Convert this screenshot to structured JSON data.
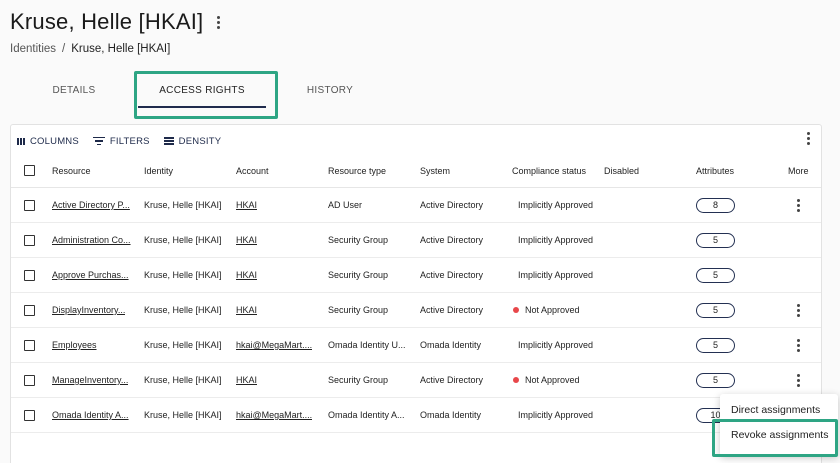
{
  "page": {
    "title": "Kruse, Helle [HKAI]",
    "title_menu_icon": "more-vertical-icon"
  },
  "breadcrumb": {
    "parent": "Identities",
    "separator": "/",
    "current": "Kruse, Helle [HKAI]"
  },
  "tabs": [
    {
      "label": "DETAILS",
      "active": false
    },
    {
      "label": "ACCESS RIGHTS",
      "active": true
    },
    {
      "label": "HISTORY",
      "active": false
    }
  ],
  "toolbar": {
    "columns_label": "COLUMNS",
    "filters_label": "FILTERS",
    "density_label": "DENSITY",
    "more_icon": "more-vertical-icon"
  },
  "columns": {
    "resource": "Resource",
    "identity": "Identity",
    "account": "Account",
    "resource_type": "Resource type",
    "system": "System",
    "compliance_status": "Compliance status",
    "disabled": "Disabled",
    "attributes": "Attributes",
    "more": "More"
  },
  "rows": [
    {
      "resource": "Active Directory P...",
      "identity": "Kruse, Helle [HKAI]",
      "account": "HKAI",
      "resource_type": "AD User",
      "system": "Active Directory",
      "compliance": "Implicitly Approved",
      "not_approved": false,
      "attributes": "8",
      "has_more": true
    },
    {
      "resource": "Administration Co...",
      "identity": "Kruse, Helle [HKAI]",
      "account": "HKAI",
      "resource_type": "Security Group",
      "system": "Active Directory",
      "compliance": "Implicitly Approved",
      "not_approved": false,
      "attributes": "5",
      "has_more": false
    },
    {
      "resource": "Approve Purchas...",
      "identity": "Kruse, Helle [HKAI]",
      "account": "HKAI",
      "resource_type": "Security Group",
      "system": "Active Directory",
      "compliance": "Implicitly Approved",
      "not_approved": false,
      "attributes": "5",
      "has_more": false
    },
    {
      "resource": "DisplayInventory...",
      "identity": "Kruse, Helle [HKAI]",
      "account": "HKAI",
      "resource_type": "Security Group",
      "system": "Active Directory",
      "compliance": "Not Approved",
      "not_approved": true,
      "attributes": "5",
      "has_more": true
    },
    {
      "resource": "Employees",
      "identity": "Kruse, Helle [HKAI]",
      "account": "hkai@MegaMart....",
      "resource_type": "Omada Identity U...",
      "system": "Omada Identity",
      "compliance": "Implicitly Approved",
      "not_approved": false,
      "attributes": "5",
      "has_more": true
    },
    {
      "resource": "ManageInventory...",
      "identity": "Kruse, Helle [HKAI]",
      "account": "HKAI",
      "resource_type": "Security Group",
      "system": "Active Directory",
      "compliance": "Not Approved",
      "not_approved": true,
      "attributes": "5",
      "has_more": true
    },
    {
      "resource": "Omada Identity A...",
      "identity": "Kruse, Helle [HKAI]",
      "account": "hkai@MegaMart....",
      "resource_type": "Omada Identity A...",
      "system": "Omada Identity",
      "compliance": "Implicitly Approved",
      "not_approved": false,
      "attributes": "10",
      "has_more": false
    }
  ],
  "context_menu": {
    "items": [
      "Direct assignments",
      "Revoke assignments"
    ]
  },
  "colors": {
    "highlight": "#2ea584",
    "not_approved_dot": "#e8474a",
    "tab_indicator": "#1f2b4d"
  }
}
